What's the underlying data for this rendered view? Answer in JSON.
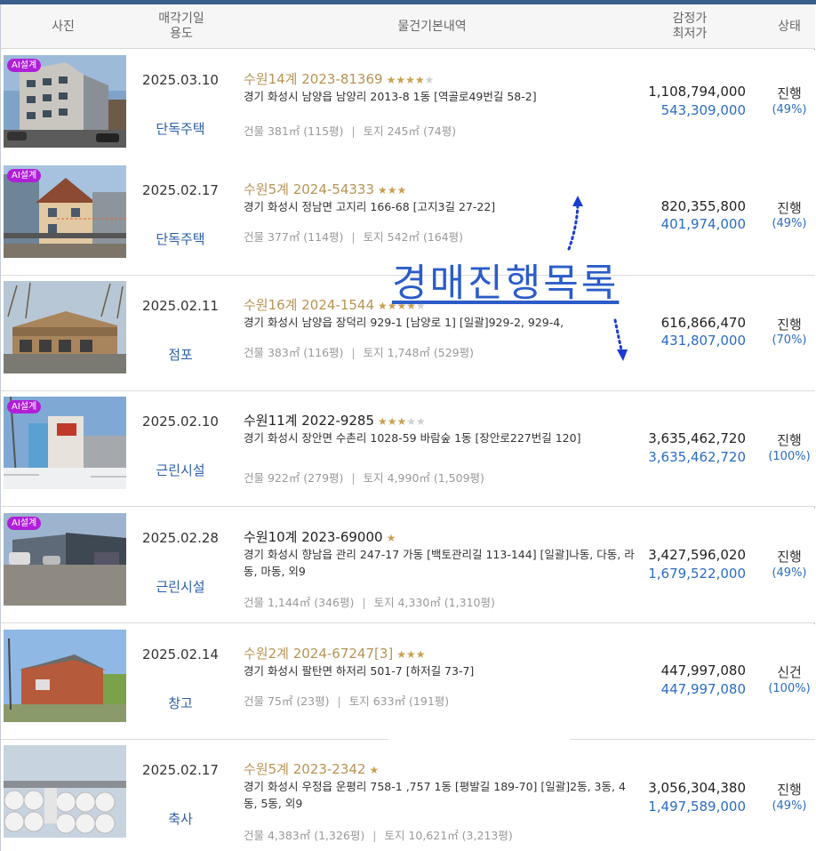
{
  "header": {
    "photo": "사진",
    "date_line1": "매각기일",
    "date_line2": "용도",
    "info": "물건기본내역",
    "price_line1": "감정가",
    "price_line2": "최저가",
    "status": "상태"
  },
  "overlay": {
    "title": "경매진행목록"
  },
  "colors": {
    "case_gold": "#b89354",
    "star_gold": "#c8a052",
    "link_blue": "#2b6cc2",
    "ai_badge": "#b01fd8",
    "annotation_blue": "#2b5cc8"
  },
  "items": [
    {
      "ai_badge": "AI설계",
      "date": "2025.03.10",
      "use": "단독주택",
      "case": "수원14계 2023-81369",
      "stars_on": "★★★★",
      "stars_off": "★",
      "address": "경기 화성시 남양읍 남양리 2013-8 1동 [역골로49번길 58-2]",
      "building": "건물 381㎡ (115평)",
      "land": "토지 245㎡ (74평)",
      "appraised": "1,108,794,000",
      "minimum": "543,309,000",
      "status": "진행",
      "percent": "(49%)"
    },
    {
      "ai_badge": "AI설계",
      "date": "2025.02.17",
      "use": "단독주택",
      "case": "수원5계 2024-54333",
      "stars_on": "★★★",
      "stars_off": "",
      "address": "경기 화성시 정남면 고지리 166-68 [고지3길 27-22]",
      "building": "건물 377㎡ (114평)",
      "land": "토지 542㎡ (164평)",
      "appraised": "820,355,800",
      "minimum": "401,974,000",
      "status": "진행",
      "percent": "(49%)"
    },
    {
      "ai_badge": "",
      "date": "2025.02.11",
      "use": "점포",
      "case": "수원16계 2024-1544",
      "stars_on": "★★★★",
      "stars_off": "★",
      "address": "경기 화성시 남양읍 장덕리 929-1 [남양로 1] [일괄]929-2, 929-4,",
      "building": "건물 383㎡ (116평)",
      "land": "토지 1,748㎡ (529평)",
      "appraised": "616,866,470",
      "minimum": "431,807,000",
      "status": "진행",
      "percent": "(70%)"
    },
    {
      "ai_badge": "AI설계",
      "date": "2025.02.10",
      "use": "근린시설",
      "case": "수원11계 2022-9285",
      "stars_on": "★★★",
      "stars_off": "★★",
      "address": "경기 화성시 장안면 수촌리 1028-59 바람숲 1동 [장안로227번길 120]",
      "building": "건물 922㎡ (279평)",
      "land": "토지 4,990㎡ (1,509평)",
      "appraised": "3,635,462,720",
      "minimum": "3,635,462,720",
      "status": "진행",
      "percent": "(100%)"
    },
    {
      "ai_badge": "AI설계",
      "date": "2025.02.28",
      "use": "근린시설",
      "case": "수원10계 2023-69000",
      "stars_on": "★",
      "stars_off": "",
      "address": "경기 화성시 향남읍 관리 247-17 가동 [백토관리길 113-144] [일괄]나동, 다동, 라동, 마동, 외9",
      "building": "건물 1,144㎡ (346평)",
      "land": "토지 4,330㎡ (1,310평)",
      "appraised": "3,427,596,020",
      "minimum": "1,679,522,000",
      "status": "진행",
      "percent": "(49%)"
    },
    {
      "ai_badge": "",
      "date": "2025.02.14",
      "use": "창고",
      "case": "수원2계 2024-67247[3]",
      "stars_on": "★★★",
      "stars_off": "",
      "address": "경기 화성시 팔탄면 하저리 501-7 [하저길 73-7]",
      "building": "건물 75㎡ (23평)",
      "land": "토지 633㎡ (191평)",
      "appraised": "447,997,080",
      "minimum": "447,997,080",
      "status": "신건",
      "percent": "(100%)"
    },
    {
      "ai_badge": "",
      "date": "2025.02.17",
      "use": "축사",
      "case": "수원5계 2023-2342",
      "stars_on": "★",
      "stars_off": "",
      "address": "경기 화성시 우정읍 운평리 758-1 ,757 1동 [평발길 189-70] [일괄]2동, 3동, 4동, 5동, 외9",
      "building": "건물 4,383㎡ (1,326평)",
      "land": "토지 10,621㎡ (3,213평)",
      "appraised": "3,056,304,380",
      "minimum": "1,497,589,000",
      "status": "진행",
      "percent": "(49%)"
    }
  ]
}
